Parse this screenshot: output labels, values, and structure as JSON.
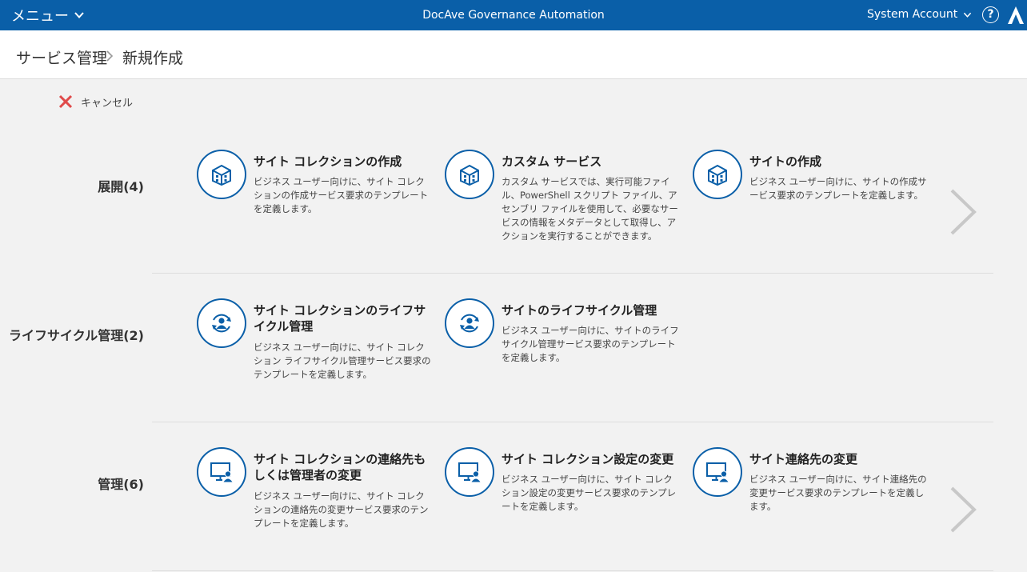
{
  "header": {
    "menu_label": "メニュー",
    "app_title": "DocAve Governance Automation",
    "account_label": "System Account",
    "help_label": "?"
  },
  "breadcrumb": {
    "root": "サービス管理",
    "current": "新規作成"
  },
  "toolbar": {
    "cancel_label": "キャンセル"
  },
  "categories": [
    {
      "label": "展開(4)",
      "cards": [
        {
          "title": "サイト コレクションの作成",
          "description": "ビジネス ユーザー向けに、サイト コレクションの作成サービス要求のテンプレートを定義します。",
          "icon": "building-icon"
        },
        {
          "title": "カスタム サービス",
          "description": "カスタム サービスでは、実行可能ファイル、PowerShell スクリプト ファイル、アセンブリ ファイルを使用して、必要なサービスの情報をメタデータとして取得し、アクションを実行することができます。",
          "icon": "building-icon"
        },
        {
          "title": "サイトの作成",
          "description": "ビジネス ユーザー向けに、サイトの作成サービス要求のテンプレートを定義します。",
          "icon": "building-icon"
        }
      ]
    },
    {
      "label": "ライフサイクル管理(2)",
      "cards": [
        {
          "title": "サイト コレクションのライフサイクル管理",
          "description": "ビジネス ユーザー向けに、サイト コレクション ライフサイクル管理サービス要求のテンプレートを定義します。",
          "icon": "lifecycle-icon"
        },
        {
          "title": "サイトのライフサイクル管理",
          "description": "ビジネス ユーザー向けに、サイトのライフサイクル管理サービス要求のテンプレートを定義します。",
          "icon": "lifecycle-icon"
        }
      ]
    },
    {
      "label": "管理(6)",
      "cards": [
        {
          "title": "サイト コレクションの連絡先もしくは管理者の変更",
          "description": "ビジネス ユーザー向けに、サイト コレクションの連絡先の変更サービス要求のテンプレートを定義します。",
          "icon": "monitor-user-icon"
        },
        {
          "title": "サイト コレクション設定の変更",
          "description": "ビジネス ユーザー向けに、サイト コレクション設定の変更サービス要求のテンプレートを定義します。",
          "icon": "monitor-user-icon"
        },
        {
          "title": "サイト連絡先の変更",
          "description": "ビジネス ユーザー向けに、サイト連絡先の変更サービス要求のテンプレートを定義します。",
          "icon": "monitor-user-icon"
        }
      ]
    }
  ],
  "colors": {
    "brand": "#0a5fa8",
    "cancel": "#e04a4a",
    "arrow": "#c8c8c8"
  }
}
